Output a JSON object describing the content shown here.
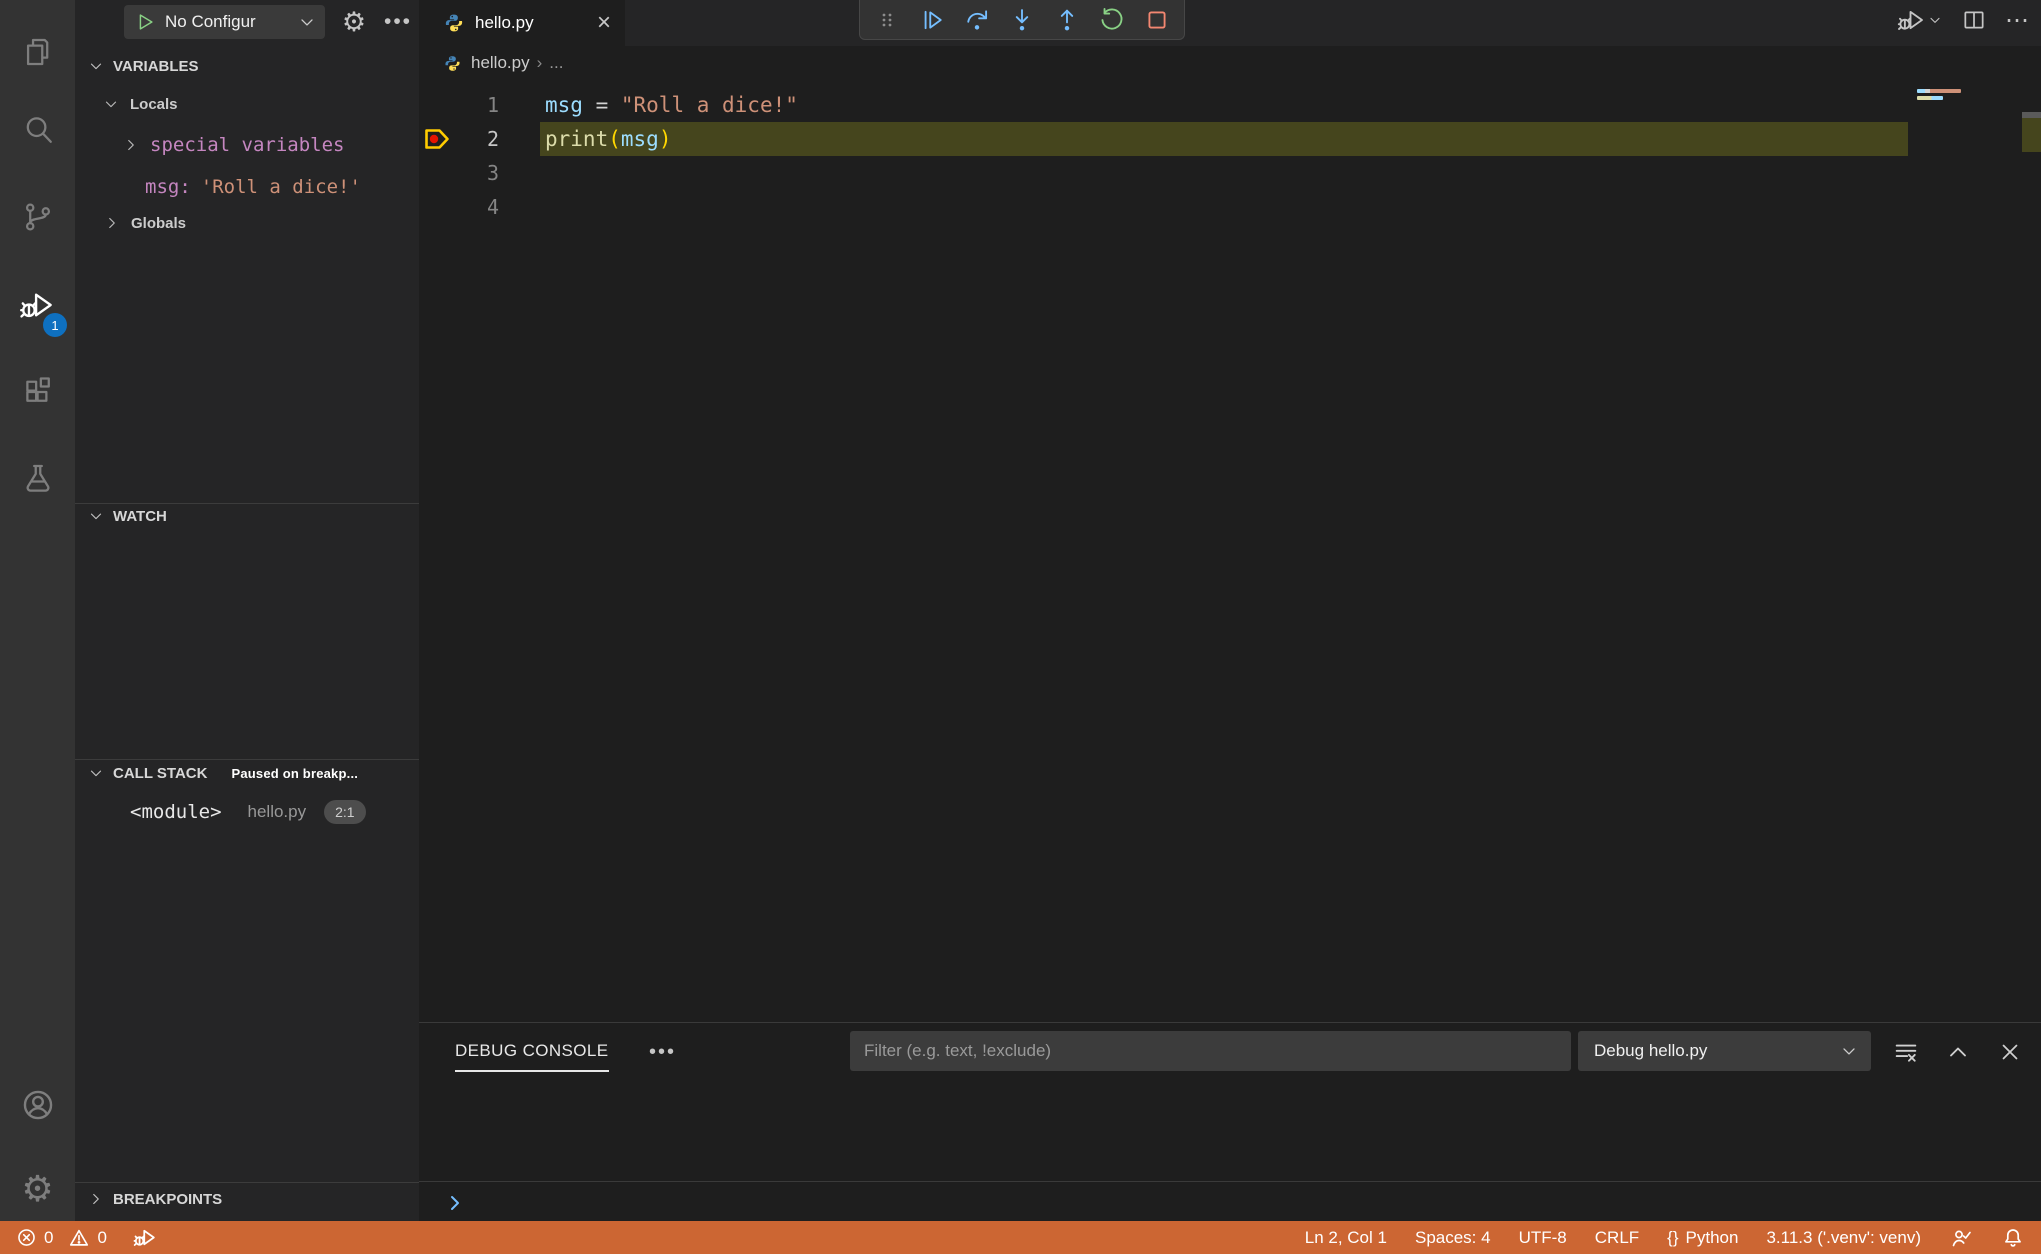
{
  "colors": {
    "status_bar_bg": "#cc6633",
    "badge_bg": "#0e70c0",
    "debug_accent_blue": "#75beff",
    "debug_accent_green": "#89d185",
    "debug_accent_red": "#f48771",
    "current_line_highlight": "#45451d"
  },
  "activity_bar": {
    "items": [
      {
        "name": "explorer",
        "icon": "files-icon"
      },
      {
        "name": "search",
        "icon": "search-icon"
      },
      {
        "name": "source-control",
        "icon": "git-branch-icon"
      },
      {
        "name": "run-and-debug",
        "icon": "bug-play-icon",
        "active": true,
        "badge": "1"
      },
      {
        "name": "extensions",
        "icon": "extensions-icon"
      },
      {
        "name": "testing",
        "icon": "flask-icon"
      }
    ],
    "bottom_items": [
      {
        "name": "accounts",
        "icon": "account-icon"
      },
      {
        "name": "settings",
        "icon": "gear-icon",
        "glyph": "⚙"
      }
    ],
    "debug_badge": "1"
  },
  "sidebar": {
    "config_button": {
      "label": "No Configur",
      "icon": "play-icon"
    },
    "toolbar": {
      "gear_glyph": "⚙",
      "more_glyph": "•••"
    },
    "variables": {
      "title": "VARIABLES",
      "locals_label": "Locals",
      "special_variables_label": "special variables",
      "msg_name": "msg:",
      "msg_value": "'Roll a dice!'",
      "globals_label": "Globals"
    },
    "watch": {
      "title": "WATCH"
    },
    "call_stack": {
      "title": "CALL STACK",
      "status": "Paused on breakp...",
      "frame": {
        "name": "<module>",
        "file": "hello.py",
        "position": "2:1"
      }
    },
    "breakpoints": {
      "title": "BREAKPOINTS"
    }
  },
  "editor": {
    "tab": {
      "title": "hello.py",
      "icon": "python-icon",
      "close_glyph": "×"
    },
    "breadcrumb": {
      "file": "hello.py",
      "separator": "›",
      "symbol": "..."
    },
    "debug_toolbar_icons": [
      "drag-grip-icon",
      "continue-icon",
      "step-over-icon",
      "step-into-icon",
      "step-out-icon",
      "restart-icon",
      "stop-icon"
    ],
    "editor_action_icons": [
      "run-or-debug-icon",
      "split-editor-icon",
      "more-actions-icon"
    ],
    "more_actions_glyph": "⋯",
    "lines": [
      {
        "num": "1",
        "tokens": [
          {
            "type": "var",
            "text": "msg"
          },
          {
            "type": "op",
            "text": " = "
          },
          {
            "type": "str",
            "text": "\"Roll a dice!\""
          }
        ]
      },
      {
        "num": "2",
        "tokens": [
          {
            "type": "func",
            "text": "print"
          },
          {
            "type": "paren",
            "text": "("
          },
          {
            "type": "var",
            "text": "msg"
          },
          {
            "type": "paren",
            "text": ")"
          }
        ]
      },
      {
        "num": "3",
        "tokens": []
      },
      {
        "num": "4",
        "tokens": []
      }
    ],
    "paused_line": "2",
    "breakpoint_line": "2"
  },
  "panel": {
    "tab": "DEBUG CONSOLE",
    "more_glyph": "•••",
    "filter_placeholder": "Filter (e.g. text, !exclude)",
    "console_select": "Debug hello.py",
    "action_icons": [
      "clear-console-icon",
      "maximize-panel-icon",
      "close-panel-icon"
    ],
    "repl_prompt_icon": "chevron-right-icon"
  },
  "status_bar": {
    "errors": "0",
    "warnings": "0",
    "cursor": "Ln 2, Col 1",
    "indent": "Spaces: 4",
    "encoding": "UTF-8",
    "eol": "CRLF",
    "language_icon": "{}",
    "language": "Python",
    "interpreter": "3.11.3 ('.venv': venv)"
  }
}
